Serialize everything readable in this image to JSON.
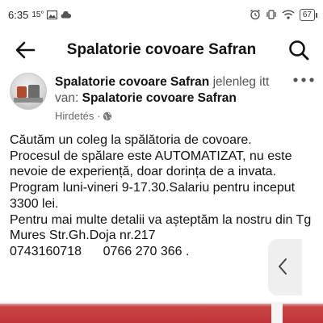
{
  "status_bar": {
    "time": "6:35",
    "temperature": "15°",
    "battery": "67",
    "icons": [
      "image-icon",
      "cloud-icon",
      "alarm-icon",
      "vibrate-icon",
      "wifi-icon",
      "battery-icon"
    ]
  },
  "app_bar": {
    "title": "Spalatorie covoare Safran",
    "back_icon": "arrow-left-icon",
    "search_icon": "search-icon"
  },
  "post": {
    "page_name": "Spalatorie covoare Safran",
    "status_text": "jelenleg itt van:",
    "location": "Spalatorie covoare Safran",
    "sponsored": "Hirdetés ·",
    "sponsored_icon": "globe-icon",
    "more_icon": "more-icon",
    "body": [
      "Căutăm un coleg la spălătoria de covoare.",
      "Procesul de spălare este AUTOMATIZAT, nu este nevoie de experiență, doar dorința de a invata.",
      "Program luni-vineri 9-17.30.Salariu pentru inceput 3300 lei.",
      "Pentru mai multe detalii va așteptăm la nostru din Tg Mures Str.Gh.Doja nr.217",
      "0743160718      0766 270 366 ."
    ]
  },
  "floating_panel": {
    "icon": "chevron-left-icon"
  },
  "colors": {
    "bottom_band": "#c2353a",
    "floating_panel": "#efefef"
  }
}
